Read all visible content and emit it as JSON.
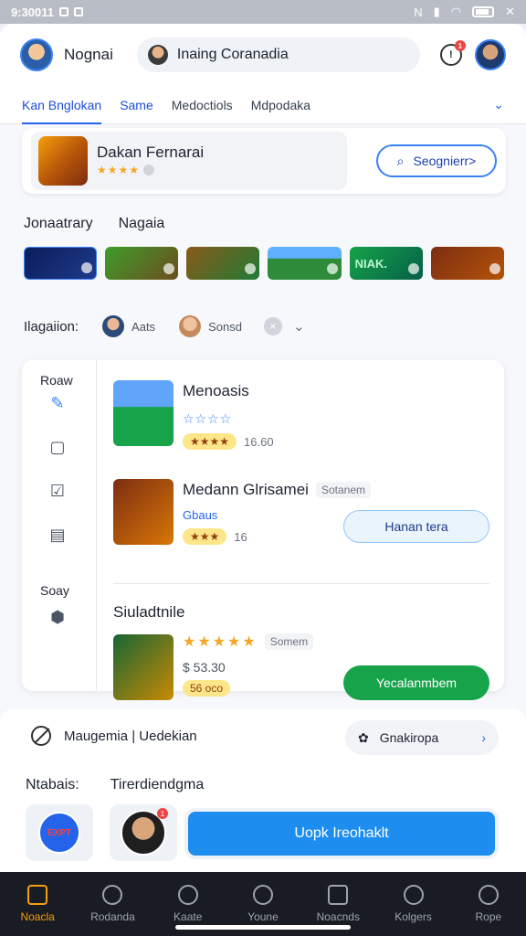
{
  "status_bar": {
    "time": "9:30011",
    "right_text": "N"
  },
  "header": {
    "app_name": "Nognai",
    "search_text": "Inaing Coranadia",
    "notif_badge": "1"
  },
  "tabs": {
    "items": [
      "Kan Bnglokan",
      "Same",
      "Medoctiols",
      "Mdpodaka"
    ]
  },
  "featured": {
    "title": "Dakan Fernarai",
    "stars": "★★★★",
    "button_label": "Seognierr>"
  },
  "sections": {
    "left": "Jonaatrary",
    "right": "Nagaia"
  },
  "thumbs": {
    "t5_label": "NIAK."
  },
  "filters": {
    "label": "Ilagaiion:",
    "chip1": "Aats",
    "chip2": "Sonsd",
    "clear": "×"
  },
  "side_panel": {
    "label_top": "Roaw",
    "label_bottom": "Soay"
  },
  "games": {
    "g1": {
      "title": "Menoasis",
      "stars": "☆☆☆☆",
      "rating_pill": "★★★★",
      "meta": "16.60"
    },
    "g2": {
      "title": "Medann Glrisamei",
      "tag": "Sotanem",
      "sub": "Gbaus",
      "rating_pill": "★★★",
      "meta": "16",
      "button": "Hanan tera"
    },
    "section_title": "Siuladtnile",
    "g3": {
      "stars": "★★★★★",
      "tag": "Somem",
      "price": "$ 53.30",
      "pill": "56 oco",
      "button": "Yecalanmbem"
    }
  },
  "bottom": {
    "row1_label": "Maugemia | Uedekian",
    "category_pill": "Gnakiropa",
    "left_label": "Ntabais:",
    "right_label": "Tirerdiendgma",
    "tile_logo_text": "EXPT",
    "tile_badge": "1",
    "cta_label": "Uopk Ireohaklt"
  },
  "nav": {
    "items": [
      "Noacla",
      "Rodanda",
      "Kaate",
      "Youne",
      "Noacnds",
      "Kolgers",
      "Rope"
    ]
  }
}
